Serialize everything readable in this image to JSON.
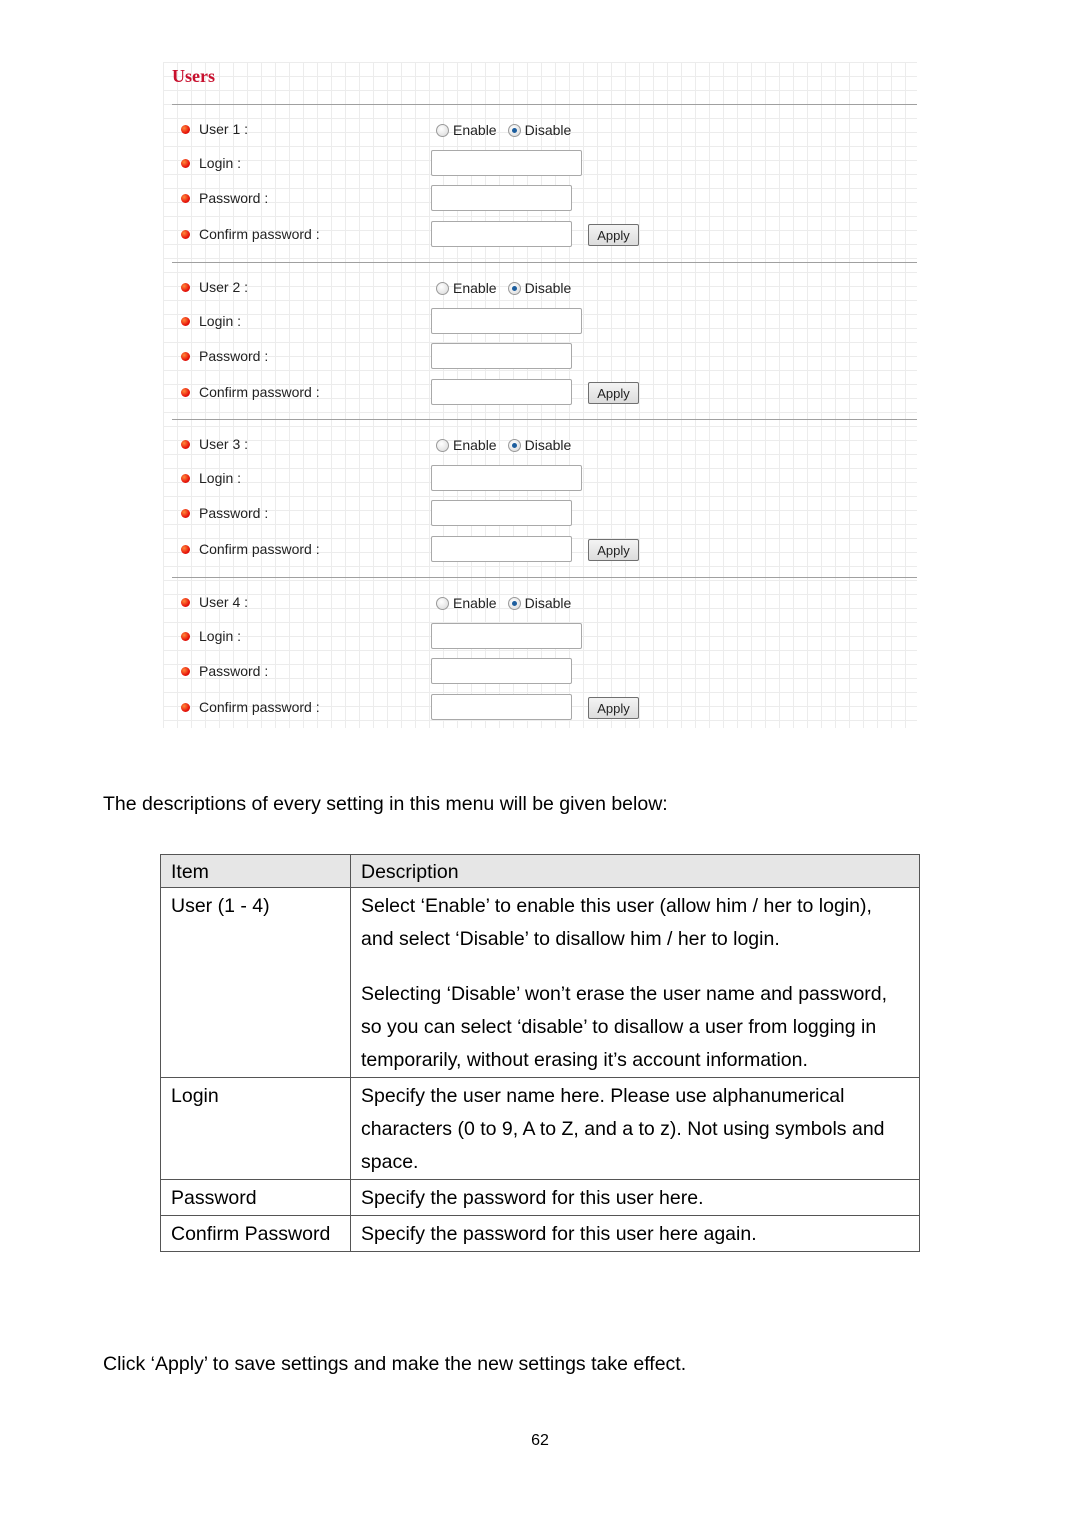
{
  "screenshot": {
    "title": "Users",
    "users": [
      {
        "label": "User 1 :",
        "enable_label": "Enable",
        "disable_label": "Disable",
        "selected": "Disable",
        "login_label": "Login :",
        "login_value": "",
        "password_label": "Password :",
        "password_value": "",
        "confirm_label": "Confirm password :",
        "confirm_value": "",
        "apply_label": "Apply"
      },
      {
        "label": "User 2 :",
        "enable_label": "Enable",
        "disable_label": "Disable",
        "selected": "Disable",
        "login_label": "Login :",
        "login_value": "",
        "password_label": "Password :",
        "password_value": "",
        "confirm_label": "Confirm password :",
        "confirm_value": "",
        "apply_label": "Apply"
      },
      {
        "label": "User 3 :",
        "enable_label": "Enable",
        "disable_label": "Disable",
        "selected": "Disable",
        "login_label": "Login :",
        "login_value": "",
        "password_label": "Password :",
        "password_value": "",
        "confirm_label": "Confirm password :",
        "confirm_value": "",
        "apply_label": "Apply"
      },
      {
        "label": "User 4 :",
        "enable_label": "Enable",
        "disable_label": "Disable",
        "selected": "Disable",
        "login_label": "Login :",
        "login_value": "",
        "password_label": "Password :",
        "password_value": "",
        "confirm_label": "Confirm password :",
        "confirm_value": "",
        "apply_label": "Apply"
      }
    ],
    "colors": {
      "title": "#c8102e",
      "bullet": "#e8160c",
      "radio_selected": "#1d5e9e"
    }
  },
  "intro": "The descriptions of every setting in this menu will be given below:",
  "table": {
    "headers": [
      "Item",
      "Description"
    ],
    "rows": [
      {
        "item": "User (1 - 4)",
        "description": [
          "Select ‘Enable’ to enable this user (allow him / her to login), and select ‘Disable’ to disallow him / her to login.",
          "Selecting ‘Disable’ won’t erase the user name and password, so you can select ‘disable’ to disallow a user from logging in temporarily, without erasing it’s account information."
        ]
      },
      {
        "item": "Login",
        "description": [
          "Specify the user name here. Please use alphanumerical characters (0 to 9, A to Z, and a to z). Not using symbols and space."
        ]
      },
      {
        "item": "Password",
        "description": [
          "Specify the password for this user here."
        ]
      },
      {
        "item": "Confirm Password",
        "description": [
          "Specify the password for this user here again."
        ]
      }
    ]
  },
  "outro": "Click ‘Apply’ to save settings and make the new settings take effect.",
  "page_number": "62"
}
